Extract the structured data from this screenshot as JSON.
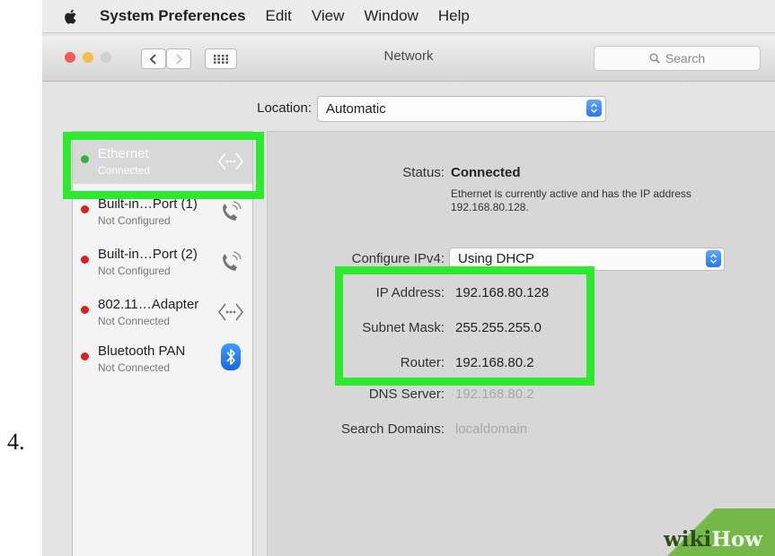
{
  "step_number": "4.",
  "menubar": {
    "items": [
      "System Preferences",
      "Edit",
      "View",
      "Window",
      "Help"
    ]
  },
  "window": {
    "title": "Network",
    "search_placeholder": "Search"
  },
  "location": {
    "label": "Location:",
    "value": "Automatic"
  },
  "services": [
    {
      "name": "Ethernet",
      "status": "Connected",
      "icon": "ethernet-arrows-icon",
      "state": "green"
    },
    {
      "name": "Built-in…Port (1)",
      "status": "Not Configured",
      "icon": "phone-icon",
      "state": "red"
    },
    {
      "name": "Built-in…Port (2)",
      "status": "Not Configured",
      "icon": "phone-icon",
      "state": "red"
    },
    {
      "name": "802.11…Adapter",
      "status": "Not Connected",
      "icon": "ethernet-arrows-icon",
      "state": "red"
    },
    {
      "name": "Bluetooth PAN",
      "status": "Not Connected",
      "icon": "bluetooth-icon",
      "state": "red"
    }
  ],
  "details": {
    "status_label": "Status:",
    "status_value": "Connected",
    "status_description": "Ethernet is currently active and has the IP address 192.168.80.128.",
    "configure_label": "Configure IPv4:",
    "configure_value": "Using DHCP",
    "ip_label": "IP Address:",
    "ip_value": "192.168.80.128",
    "subnet_label": "Subnet Mask:",
    "subnet_value": "255.255.255.0",
    "router_label": "Router:",
    "router_value": "192.168.80.2",
    "dns_label": "DNS Server:",
    "dns_value": "192.168.80.2",
    "search_domains_label": "Search Domains:",
    "search_domains_value": "localdomain"
  },
  "watermark": {
    "part1": "wiki",
    "part2": "How"
  },
  "colors": {
    "highlight": "#2dea2f",
    "connected_dot": "#35b13a",
    "disconnected_dot": "#dc1f1f",
    "stepper_blue": "#2a76e8"
  }
}
